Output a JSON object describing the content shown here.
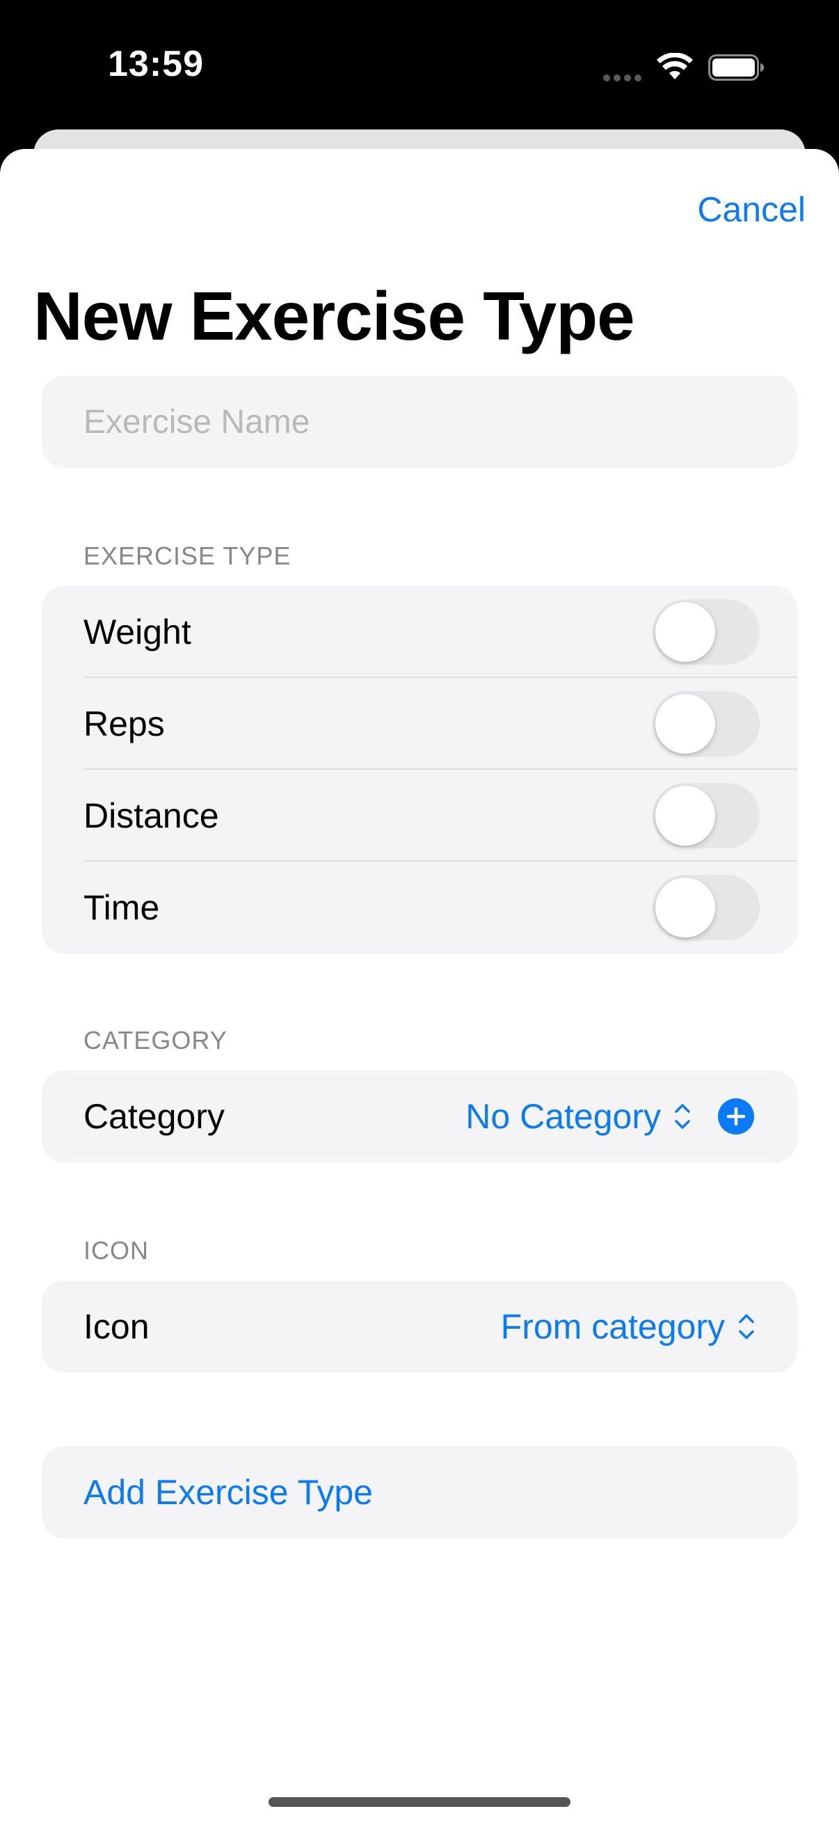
{
  "status_bar": {
    "time": "13:59"
  },
  "sheet": {
    "cancel_label": "Cancel",
    "title": "New Exercise Type"
  },
  "name_field": {
    "placeholder": "Exercise Name",
    "value": ""
  },
  "exercise_type": {
    "header": "EXERCISE TYPE",
    "rows": [
      {
        "label": "Weight",
        "enabled": false
      },
      {
        "label": "Reps",
        "enabled": false
      },
      {
        "label": "Distance",
        "enabled": false
      },
      {
        "label": "Time",
        "enabled": false
      }
    ]
  },
  "category": {
    "header": "CATEGORY",
    "label": "Category",
    "value": "No Category"
  },
  "icon": {
    "header": "ICON",
    "label": "Icon",
    "value": "From category"
  },
  "add_button_label": "Add Exercise Type",
  "colors": {
    "accent": "#0a7bf5",
    "card_background": "#f4f3f5",
    "toggle_off": "#e6e6e9"
  }
}
